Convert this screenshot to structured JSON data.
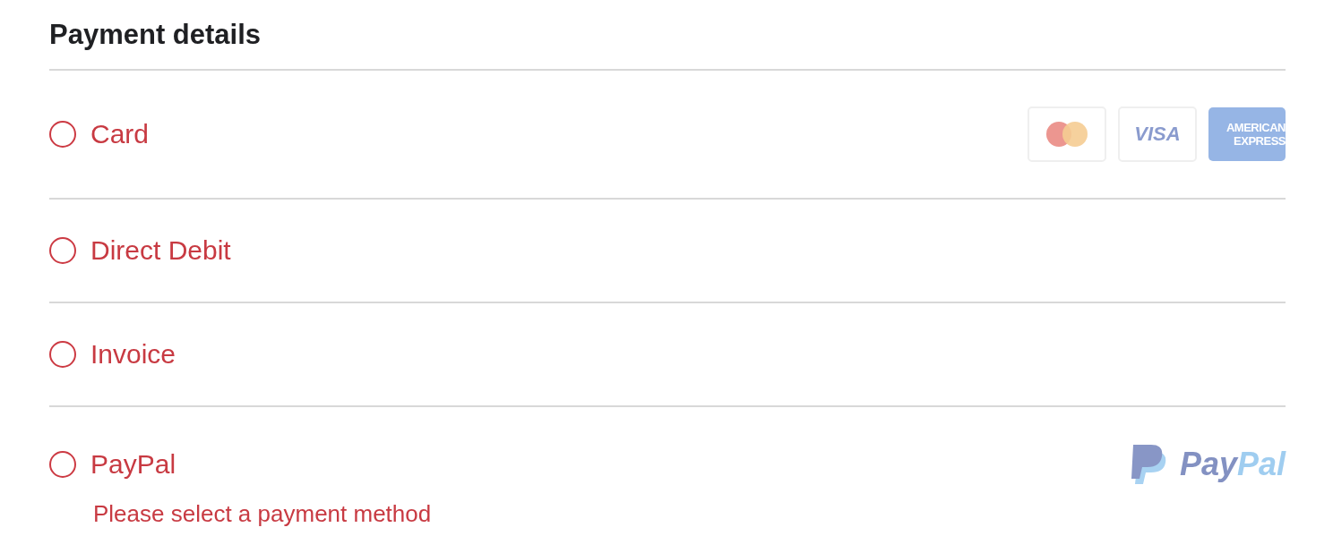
{
  "title": "Payment details",
  "methods": [
    {
      "label": "Card",
      "selected": false,
      "logos": [
        {
          "kind": "mastercard"
        },
        {
          "kind": "visa",
          "text": "VISA"
        },
        {
          "kind": "amex",
          "lines": [
            "AMERICAN",
            "EXPRESS"
          ]
        }
      ]
    },
    {
      "label": "Direct Debit",
      "selected": false
    },
    {
      "label": "Invoice",
      "selected": false
    },
    {
      "label": "PayPal",
      "selected": false,
      "logos": [
        {
          "kind": "paypal",
          "text_1": "Pay",
          "text_2": "Pal"
        }
      ]
    }
  ],
  "error": "Please select a payment method"
}
